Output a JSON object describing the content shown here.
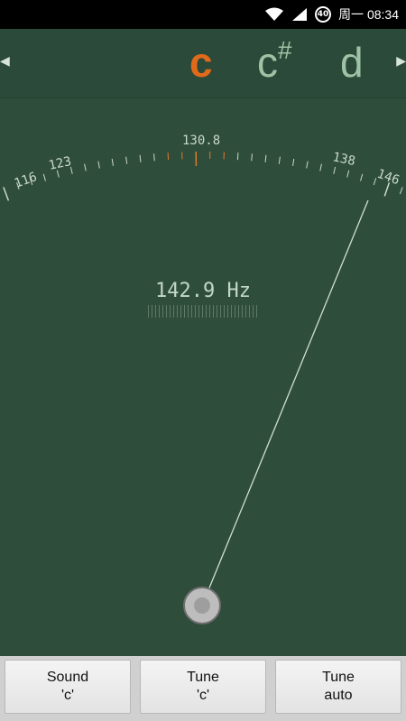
{
  "status": {
    "badge": "40",
    "day_time": "周一 08:34"
  },
  "notes": {
    "prev_arrow": "◀",
    "active": "c",
    "next": "c",
    "next_accidental": "#",
    "next_next": "d",
    "next_arrow": "▶"
  },
  "scale": {
    "labels": [
      "116",
      "123",
      "130.8",
      "138",
      "146"
    ]
  },
  "reading": {
    "frequency": "142.9 Hz"
  },
  "buttons": [
    {
      "line1": "Sound",
      "line2": "'c'"
    },
    {
      "line1": "Tune",
      "line2": "'c'"
    },
    {
      "line1": "Tune",
      "line2": "auto"
    }
  ]
}
